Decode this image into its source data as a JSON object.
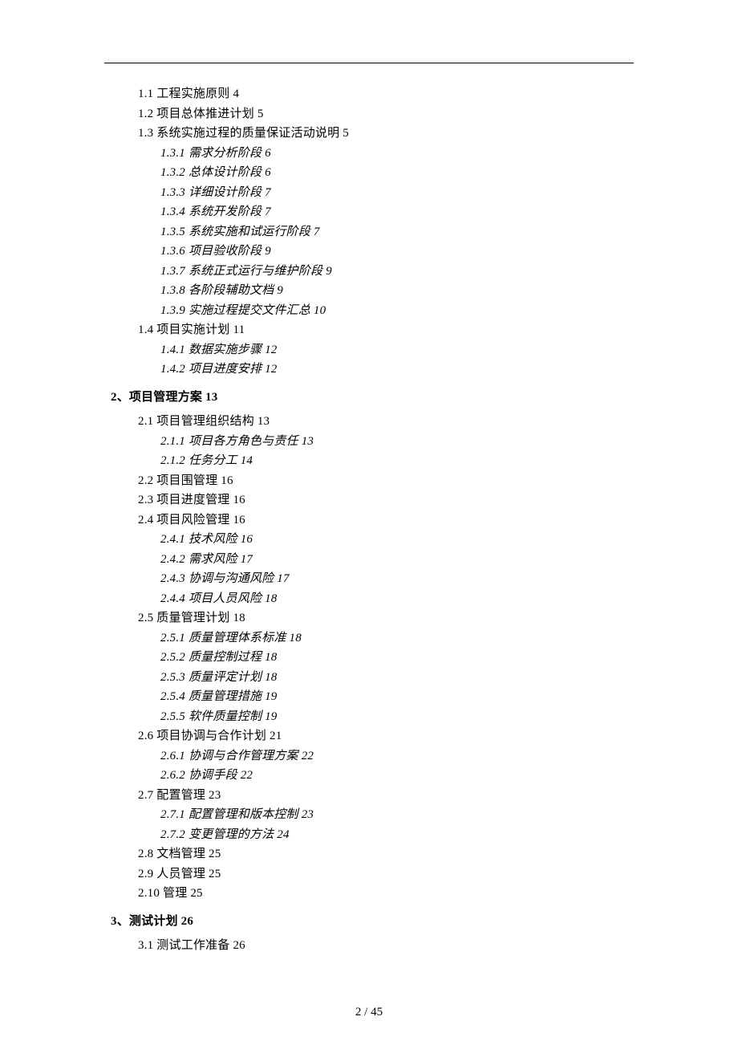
{
  "toc": [
    {
      "cls": "lvl1",
      "text": "1.1 工程实施原则 4"
    },
    {
      "cls": "lvl1",
      "text": "1.2 项目总体推进计划 5"
    },
    {
      "cls": "lvl1",
      "text": "1.3 系统实施过程的质量保证活动说明 5"
    },
    {
      "cls": "lvl2",
      "text": "1.3.1 需求分析阶段 6"
    },
    {
      "cls": "lvl2",
      "text": "1.3.2 总体设计阶段 6"
    },
    {
      "cls": "lvl2",
      "text": "1.3.3 详细设计阶段 7"
    },
    {
      "cls": "lvl2",
      "text": "1.3.4 系统开发阶段 7"
    },
    {
      "cls": "lvl2",
      "text": "1.3.5 系统实施和试运行阶段 7"
    },
    {
      "cls": "lvl2",
      "text": "1.3.6 项目验收阶段 9"
    },
    {
      "cls": "lvl2",
      "text": "1.3.7 系统正式运行与维护阶段 9"
    },
    {
      "cls": "lvl2",
      "text": "1.3.8 各阶段辅助文档 9"
    },
    {
      "cls": "lvl2",
      "text": "1.3.9 实施过程提交文件汇总 10"
    },
    {
      "cls": "lvl1",
      "text": "1.4 项目实施计划 11"
    },
    {
      "cls": "lvl2",
      "text": "1.4.1 数据实施步骤 12"
    },
    {
      "cls": "lvl2",
      "text": "1.4.2 项目进度安排 12"
    },
    {
      "cls": "sec-head",
      "text": "2、项目管理方案 13"
    },
    {
      "cls": "lvl1",
      "text": "2.1 项目管理组织结构 13"
    },
    {
      "cls": "lvl2",
      "text": "2.1.1 项目各方角色与责任 13"
    },
    {
      "cls": "lvl2",
      "text": "2.1.2 任务分工 14"
    },
    {
      "cls": "lvl1",
      "text": "2.2 项目围管理 16"
    },
    {
      "cls": "lvl1",
      "text": "2.3 项目进度管理 16"
    },
    {
      "cls": "lvl1",
      "text": "2.4 项目风险管理 16"
    },
    {
      "cls": "lvl2",
      "text": "2.4.1 技术风险 16"
    },
    {
      "cls": "lvl2",
      "text": "2.4.2 需求风险 17"
    },
    {
      "cls": "lvl2",
      "text": "2.4.3 协调与沟通风险 17"
    },
    {
      "cls": "lvl2",
      "text": "2.4.4 项目人员风险 18"
    },
    {
      "cls": "lvl1",
      "text": "2.5 质量管理计划 18"
    },
    {
      "cls": "lvl2",
      "text": "2.5.1 质量管理体系标准 18"
    },
    {
      "cls": "lvl2",
      "text": "2.5.2 质量控制过程 18"
    },
    {
      "cls": "lvl2",
      "text": "2.5.3 质量评定计划 18"
    },
    {
      "cls": "lvl2",
      "text": "2.5.4 质量管理措施 19"
    },
    {
      "cls": "lvl2",
      "text": "2.5.5 软件质量控制 19"
    },
    {
      "cls": "lvl1",
      "text": "2.6 项目协调与合作计划 21"
    },
    {
      "cls": "lvl2",
      "text": "2.6.1 协调与合作管理方案 22"
    },
    {
      "cls": "lvl2",
      "text": "2.6.2 协调手段 22"
    },
    {
      "cls": "lvl1",
      "text": "2.7 配置管理 23"
    },
    {
      "cls": "lvl2",
      "text": "2.7.1 配置管理和版本控制 23"
    },
    {
      "cls": "lvl2",
      "text": "2.7.2 变更管理的方法 24"
    },
    {
      "cls": "lvl1",
      "text": "2.8 文档管理 25"
    },
    {
      "cls": "lvl1",
      "text": "2.9 人员管理 25"
    },
    {
      "cls": "lvl1",
      "text": "2.10 管理 25"
    },
    {
      "cls": "sec-head",
      "text": "3、测试计划 26"
    },
    {
      "cls": "lvl1",
      "text": "3.1 测试工作准备 26"
    }
  ],
  "footer": "2  /  45"
}
